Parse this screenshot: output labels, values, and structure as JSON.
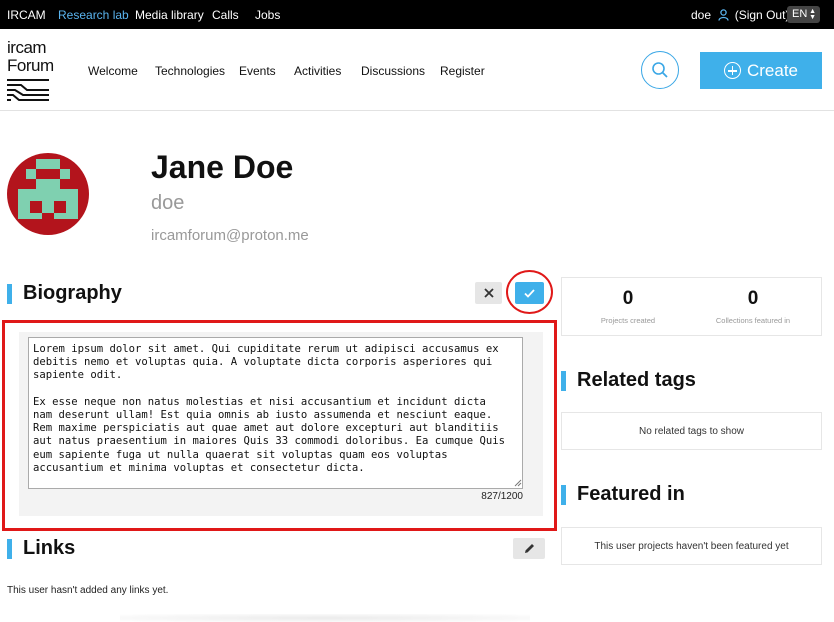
{
  "topbar": {
    "items": [
      "IRCAM",
      "Research lab",
      "Media library",
      "Calls",
      "Jobs"
    ],
    "active_index": 1,
    "username": "doe",
    "sign_out": "(Sign Out)",
    "language": "EN"
  },
  "logo": {
    "line1": "ircam",
    "line2": "Forum"
  },
  "nav": {
    "items": [
      "Welcome",
      "Technologies",
      "Events",
      "Activities",
      "Discussions",
      "Register"
    ]
  },
  "create_label": "Create",
  "profile": {
    "name": "Jane Doe",
    "username": "doe",
    "email": "ircamforum@proton.me"
  },
  "biography": {
    "title": "Biography",
    "text": "Lorem ipsum dolor sit amet. Qui cupiditate rerum ut adipisci accusamus ex\ndebitis nemo et voluptas quia. A voluptate dicta corporis asperiores qui\nsapiente odit.\n\nEx esse neque non natus molestias et nisi accusantium et incidunt dicta\nnam deserunt ullam! Est quia omnis ab iusto assumenda et nesciunt eaque.\nRem maxime perspiciatis aut quae amet aut dolore excepturi aut blanditiis\naut natus praesentium in maiores Quis 33 commodi doloribus. Ea cumque Quis\neum sapiente fuga ut nulla quaerat sit voluptas quam eos voluptas\naccusantium et minima voluptas et consectetur dicta.",
    "counter": "827/1200"
  },
  "links": {
    "title": "Links",
    "empty": "This user hasn't added any links yet."
  },
  "stats": [
    {
      "value": "0",
      "label": "Projects created"
    },
    {
      "value": "0",
      "label": "Collections featured in"
    }
  ],
  "related_tags": {
    "title": "Related tags",
    "empty": "No related tags to show"
  },
  "featured": {
    "title": "Featured in",
    "empty": "This user projects haven't been featured yet"
  },
  "colors": {
    "accent": "#3fb0ea",
    "highlight": "#e01818",
    "avatar_bg": "#b3141c",
    "avatar_fg": "#7fd0b0"
  }
}
